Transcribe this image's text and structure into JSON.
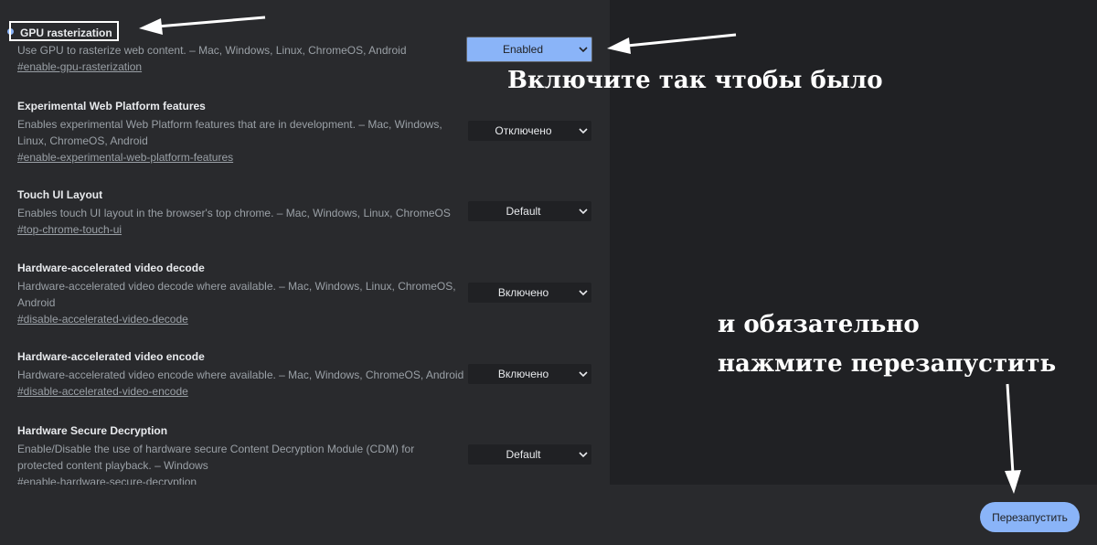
{
  "flags": [
    {
      "title": "GPU rasterization",
      "description": "Use GPU to rasterize web content. – Mac, Windows, Linux, ChromeOS, Android",
      "link": "#enable-gpu-rasterization",
      "value": "Enabled"
    },
    {
      "title": "Experimental Web Platform features",
      "description": "Enables experimental Web Platform features that are in development. – Mac, Windows, Linux, ChromeOS, Android",
      "link": "#enable-experimental-web-platform-features",
      "value": "Отключено"
    },
    {
      "title": "Touch UI Layout",
      "description": "Enables touch UI layout in the browser's top chrome. – Mac, Windows, Linux, ChromeOS",
      "link": "#top-chrome-touch-ui",
      "value": "Default"
    },
    {
      "title": "Hardware-accelerated video decode",
      "description": "Hardware-accelerated video decode where available. – Mac, Windows, Linux, ChromeOS, Android",
      "link": "#disable-accelerated-video-decode",
      "value": "Включено"
    },
    {
      "title": "Hardware-accelerated video encode",
      "description": "Hardware-accelerated video encode where available. – Mac, Windows, ChromeOS, Android",
      "link": "#disable-accelerated-video-encode",
      "value": "Включено"
    },
    {
      "title": "Hardware Secure Decryption",
      "description": "Enable/Disable the use of hardware secure Content Decryption Module (CDM) for protected content playback. – Windows",
      "link": "#enable-hardware-secure-decryption",
      "value": "Default"
    }
  ],
  "annotations": {
    "enable_hint": "Включите так чтобы было",
    "relaunch_hint_line1": "и обязательно",
    "relaunch_hint_line2": "нажмите перезапустить"
  },
  "relaunch_button": "Перезапустить",
  "colors": {
    "accent": "#8ab4f8",
    "panel": "#292a2d",
    "background": "#202124"
  }
}
